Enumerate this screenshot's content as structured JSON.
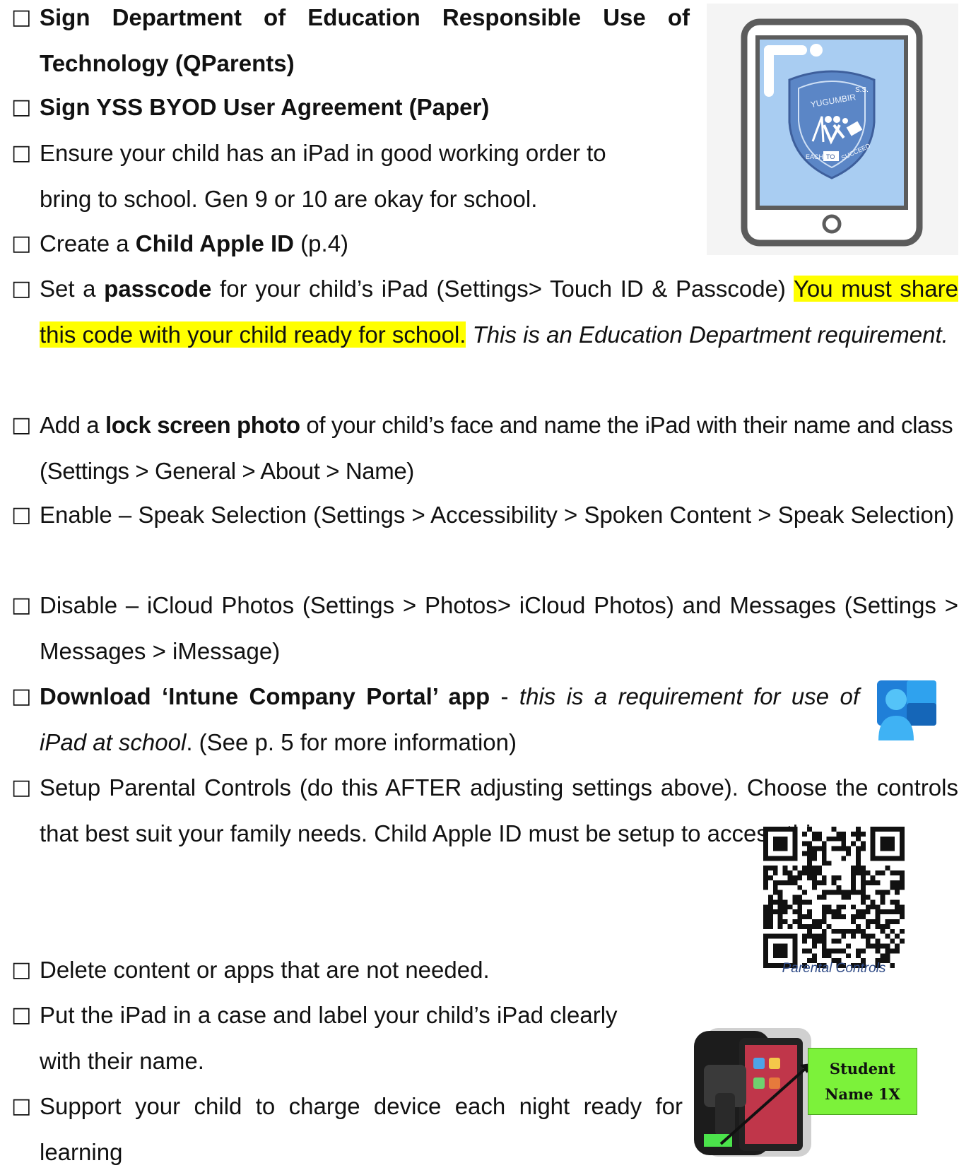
{
  "bullet_glyph": "□",
  "items": [
    {
      "parts": [
        {
          "t": "Sign Department of Education Responsible Use of Technology (QParents)",
          "s": "b"
        }
      ]
    },
    {
      "parts": [
        {
          "t": "Sign YSS BYOD User Agreement (Paper)",
          "s": "b"
        }
      ]
    },
    {
      "parts": [
        {
          "t": "Ensure your child has an iPad in good working order to bring to school. Gen 9 or 10 are okay for school."
        }
      ]
    },
    {
      "parts": [
        {
          "t": "Create a "
        },
        {
          "t": "Child Apple ID",
          "s": "b"
        },
        {
          "t": " (p.4)"
        }
      ]
    },
    {
      "parts": [
        {
          "t": "Set a "
        },
        {
          "t": "passcode",
          "s": "b"
        },
        {
          "t": " for your child’s iPad (Settings> Touch ID & Passcode) "
        },
        {
          "t": "You must share this code with your child ready for school.",
          "s": "hl"
        },
        {
          "t": " "
        },
        {
          "t": "This is an Education Department requirement.",
          "s": "i"
        }
      ]
    },
    {
      "parts": [
        {
          "t": "Add a "
        },
        {
          "t": "lock screen photo",
          "s": "b"
        },
        {
          "t": " of your child’s face and name the iPad with their name and class (Settings > General > About > Name)"
        }
      ]
    },
    {
      "parts": [
        {
          "t": "Enable – Speak Selection (Settings > Accessibility > Spoken Content > Speak Selection)"
        }
      ]
    },
    {
      "parts": [
        {
          "t": "Disable – iCloud Photos (Settings > Photos> iCloud Photos) and Messages (Settings > Messages > iMessage)"
        }
      ]
    },
    {
      "parts": [
        {
          "t": "Download ‘Intune Company Portal’ app",
          "s": "b"
        },
        {
          "t": " - "
        },
        {
          "t": "this is a requirement for use of iPad at school",
          "s": "i"
        },
        {
          "t": ". (See p. 5 for more information)"
        }
      ]
    },
    {
      "parts": [
        {
          "t": "Setup Parental Controls (do this AFTER adjusting settings above). Choose the controls that best suit your family needs. Child Apple ID must be setup to access this."
        }
      ]
    },
    {
      "parts": [
        {
          "t": "Delete content or apps that are not needed."
        }
      ]
    },
    {
      "parts": [
        {
          "t": "Put the iPad in a case and label your child’s iPad clearly with their name."
        }
      ]
    },
    {
      "parts": [
        {
          "t": "Support your child to charge device each night ready for learning"
        }
      ]
    }
  ],
  "crest": {
    "top_text": "S.S.",
    "arc_text": "YUGUMBIR",
    "motto_left": "EACH",
    "motto_mid": "TO",
    "motto_right": "SUCCEED"
  },
  "qr_caption": "Parental Controls",
  "name_label": {
    "line1": "Student",
    "line2": "Name 1X"
  },
  "colors": {
    "highlight": "#ffff00",
    "label_green": "#7cf23a",
    "crest_blue": "#5b86c6",
    "tablet_screen": "#a9cdf2"
  }
}
